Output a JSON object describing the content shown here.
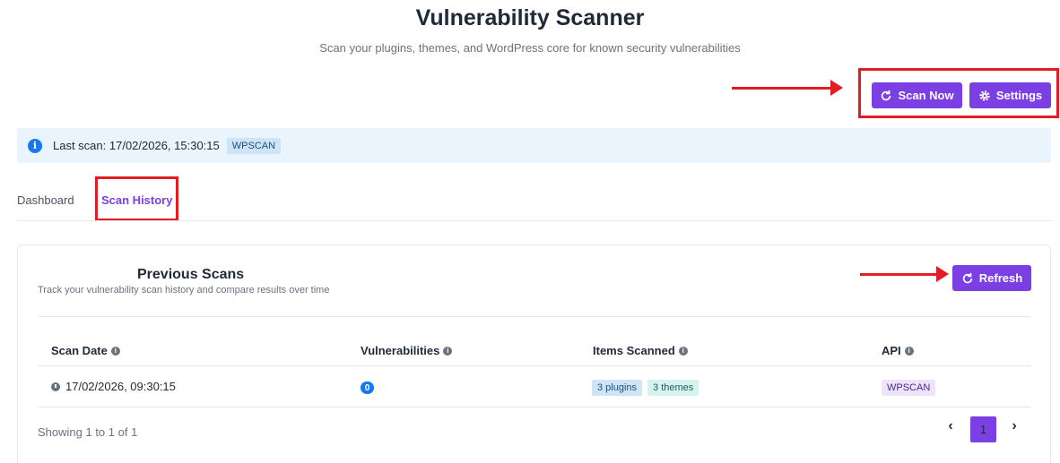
{
  "header": {
    "title": "Vulnerability Scanner",
    "subtitle": "Scan your plugins, themes, and WordPress core for known security vulnerabilities"
  },
  "toolbar": {
    "scan_now_label": "Scan Now",
    "settings_label": "Settings"
  },
  "info": {
    "last_scan_text": "Last scan: 17/02/2026, 15:30:15",
    "api_badge": "WPSCAN"
  },
  "tabs": [
    {
      "label": "Dashboard",
      "active": false
    },
    {
      "label": "Scan History",
      "active": true
    }
  ],
  "card": {
    "title": "Previous Scans",
    "subtitle": "Track your vulnerability scan history and compare results over time",
    "refresh_label": "Refresh"
  },
  "table": {
    "headers": [
      "Scan Date",
      "Vulnerabilities",
      "Items Scanned",
      "API"
    ],
    "rows": [
      {
        "date": "17/02/2026, 09:30:15",
        "vulnerabilities": "0",
        "plugins": "3 plugins",
        "themes": "3 themes",
        "api": "WPSCAN"
      }
    ]
  },
  "pagination": {
    "showing": "Showing 1 to 1 of 1",
    "current_page": "1",
    "prev_icon": "‹",
    "next_icon": "›"
  },
  "colors": {
    "accent": "#7b3fe4",
    "highlight": "#e31b23",
    "info_bg": "#eaf4fd"
  }
}
